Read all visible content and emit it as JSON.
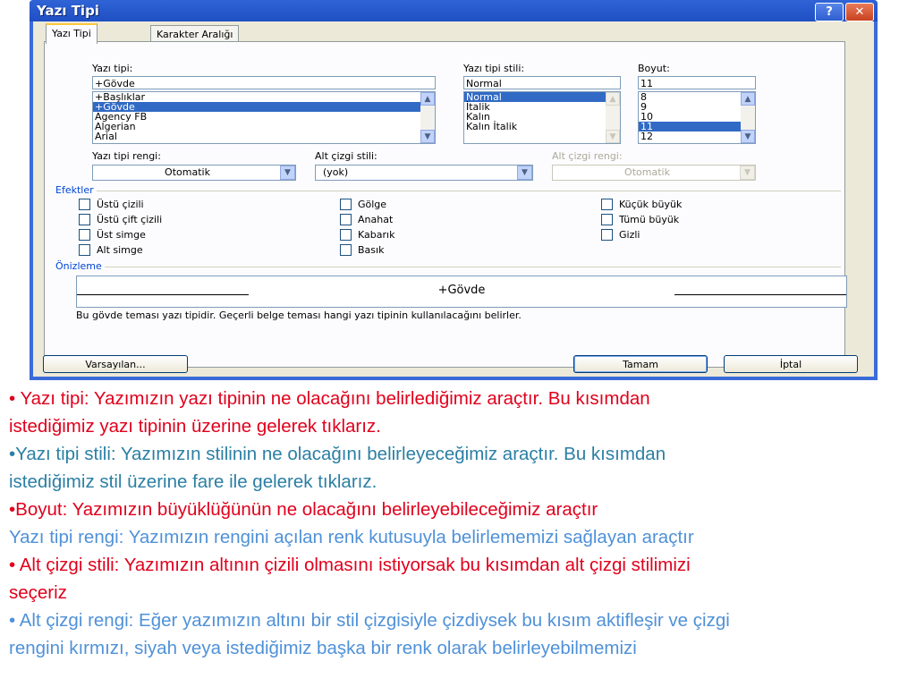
{
  "window": {
    "title": "Yazı Tipi",
    "help_label": "?",
    "close_label": "✕"
  },
  "tabs": [
    {
      "label": "Yazı Tipi"
    },
    {
      "label": "Karakter Aralığı"
    }
  ],
  "font": {
    "label": "Yazı tipi:",
    "value": "+Gövde",
    "items": [
      "+Başlıklar",
      "+Gövde",
      "Agency FB",
      "Algerian",
      "Arial"
    ],
    "selected": "+Gövde"
  },
  "style": {
    "label": "Yazı tipi stili:",
    "value": "Normal",
    "items": [
      "Normal",
      "İtalik",
      "Kalın",
      "Kalın İtalik"
    ],
    "selected": "Normal"
  },
  "size": {
    "label": "Boyut:",
    "value": "11",
    "items": [
      "8",
      "9",
      "10",
      "11",
      "12"
    ],
    "selected": "11"
  },
  "font_color": {
    "label": "Yazı tipi rengi:",
    "value": "Otomatik"
  },
  "underline_style": {
    "label": "Alt çizgi stili:",
    "value": "(yok)"
  },
  "underline_color": {
    "label": "Alt çizgi rengi:",
    "value": "Otomatik"
  },
  "effects": {
    "title": "Efektler",
    "col1": [
      "Üstü çizili",
      "Üstü çift çizili",
      "Üst simge",
      "Alt simge"
    ],
    "col2": [
      "Gölge",
      "Anahat",
      "Kabarık",
      "Basık"
    ],
    "col3": [
      "Küçük büyük",
      "Tümü büyük",
      "Gizli"
    ]
  },
  "preview": {
    "title": "Önizleme",
    "text": "+Gövde",
    "note": "Bu gövde teması yazı tipidir. Geçerli belge teması hangi yazı tipinin kullanılacağını belirler."
  },
  "buttons": {
    "default_label": "Varsayılan...",
    "ok_label": "Tamam",
    "cancel_label": "İptal"
  },
  "colors": {
    "red": "#e0001c",
    "teal": "#2b7fa4",
    "blue": "#4f91d8"
  },
  "paragraphs": [
    {
      "lines": [
        "• Yazı tipi: Yazımızın yazı tipinin ne olacağını belirlediğimiz araçtır. Bu kısımdan",
        "istediğimiz yazı tipinin üzerine gelerek tıklarız."
      ],
      "color": "red"
    },
    {
      "lines": [
        "•Yazı tipi stili: Yazımızın stilinin ne olacağını belirleyeceğimiz araçtır. Bu kısımdan",
        "istediğimiz stil üzerine fare ile gelerek tıklarız."
      ],
      "color": "teal"
    },
    {
      "lines": [
        "•Boyut: Yazımızın büyüklüğünün ne olacağını belirleyebileceğimiz araçtır"
      ],
      "color": "red"
    },
    {
      "lines": [
        " Yazı tipi rengi: Yazımızın rengini açılan renk kutusuyla belirlememizi sağlayan araçtır"
      ],
      "color": "blue"
    },
    {
      "lines": [
        "• Alt çizgi stili:  Yazımızın altının çizili olmasını istiyorsak bu kısımdan alt çizgi stilimizi",
        "seçeriz"
      ],
      "color": "red"
    },
    {
      "lines": [
        "• Alt çizgi rengi: Eğer yazımızın altını bir stil çizgisiyle çizdiysek bu kısım aktifleşir ve çizgi",
        "rengini kırmızı, siyah veya istediğimiz başka bir renk olarak belirleyebilmemizi"
      ],
      "color": "blue"
    }
  ]
}
